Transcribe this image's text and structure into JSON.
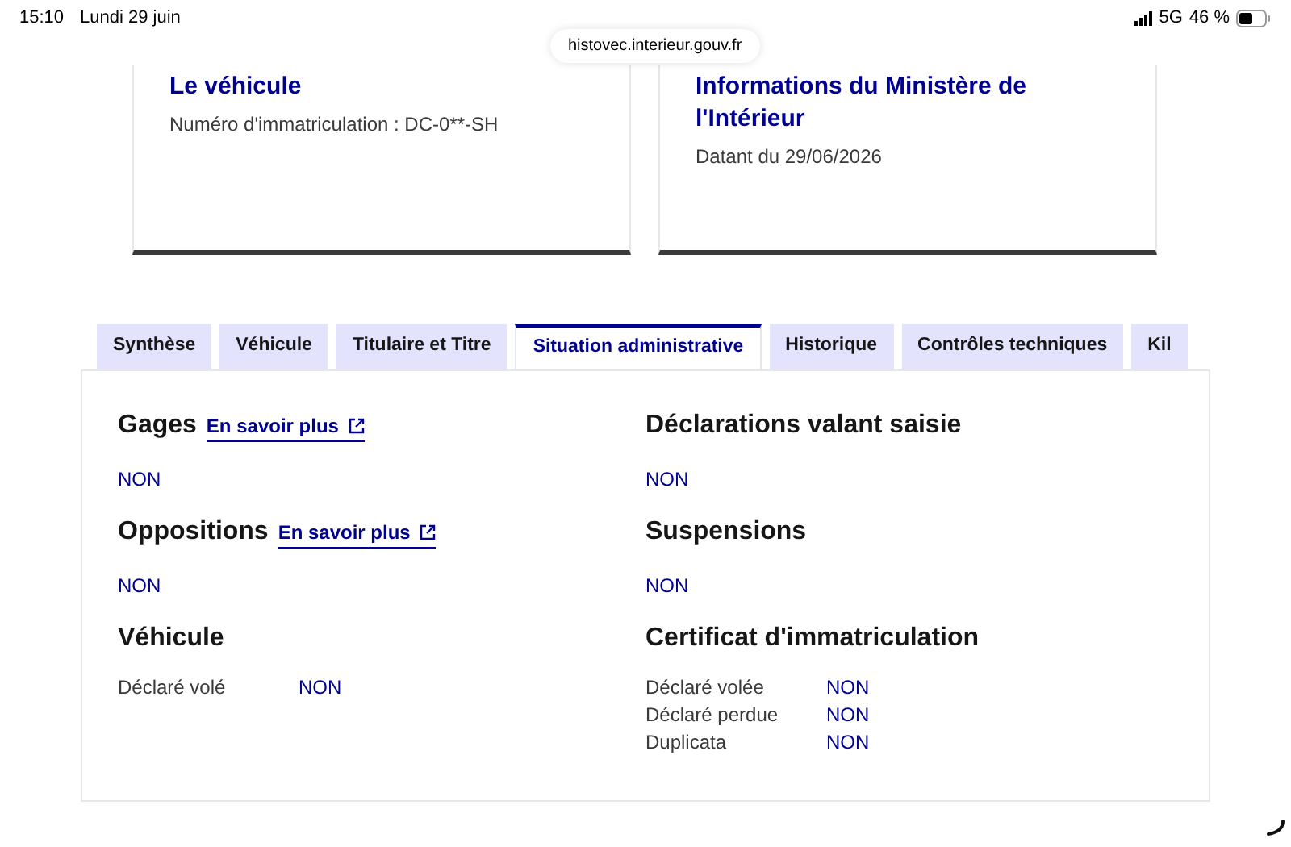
{
  "status_bar": {
    "time": "15:10",
    "date": "Lundi 29 juin",
    "network": "5G",
    "battery": "46 %"
  },
  "url": "histovec.interieur.gouv.fr",
  "cards": [
    {
      "title": "Le véhicule",
      "text": "Numéro d'immatriculation : DC-0**-SH"
    },
    {
      "title": "Informations du Ministère de l'Intérieur",
      "text": "Datant du 29/06/2026"
    }
  ],
  "tabs": [
    {
      "label": "Synthèse",
      "selected": false
    },
    {
      "label": "Véhicule",
      "selected": false
    },
    {
      "label": "Titulaire et Titre",
      "selected": false
    },
    {
      "label": "Situation administrative",
      "selected": true
    },
    {
      "label": "Historique",
      "selected": false
    },
    {
      "label": "Contrôles techniques",
      "selected": false
    },
    {
      "label": "Kil",
      "selected": false
    }
  ],
  "columns": [
    [
      {
        "kind": "flag",
        "title": "Gages",
        "link": "En savoir plus",
        "value": "NON"
      },
      {
        "kind": "flag",
        "title": "Oppositions",
        "link": "En savoir plus",
        "value": "NON"
      },
      {
        "kind": "table",
        "title": "Véhicule",
        "rows": [
          {
            "label": "Déclaré volé",
            "value": "NON"
          }
        ]
      }
    ],
    [
      {
        "kind": "flag",
        "title": "Déclarations valant saisie",
        "value": "NON"
      },
      {
        "kind": "flag",
        "title": "Suspensions",
        "value": "NON"
      },
      {
        "kind": "table",
        "title": "Certificat d'immatriculation",
        "rows": [
          {
            "label": "Déclaré volée",
            "value": "NON"
          },
          {
            "label": "Déclaré perdue",
            "value": "NON"
          },
          {
            "label": "Duplicata",
            "value": "NON"
          }
        ]
      }
    ]
  ]
}
